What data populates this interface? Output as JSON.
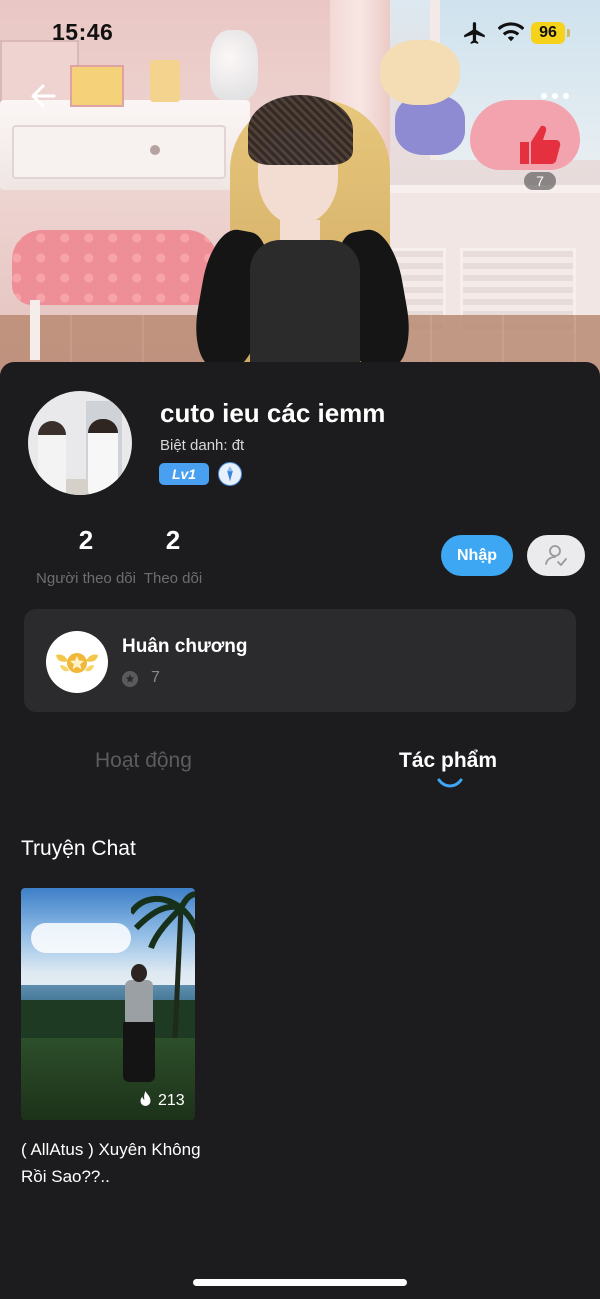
{
  "status_bar": {
    "time": "15:46",
    "battery": "96",
    "icons": [
      "airplane-mode-icon",
      "wifi-icon",
      "battery-icon"
    ]
  },
  "header": {
    "back_icon": "arrow-left-icon",
    "more_icon": "more-dots-icon",
    "like_icon": "thumbs-up-icon",
    "like_count": "7"
  },
  "profile": {
    "name": "cuto ieu các iemm",
    "nickname": "Biệt danh: đt",
    "level": "Lv1",
    "verified_icon": "verified-shield-icon"
  },
  "stats": {
    "followers": {
      "value": "2",
      "label": "Người theo dõi"
    },
    "following": {
      "value": "2",
      "label": "Theo dõi"
    }
  },
  "actions": {
    "enter_label": "Nhập",
    "follow_icon": "user-check-icon"
  },
  "medal": {
    "title": "Huân chương",
    "count": "7",
    "icon": "medal-icon"
  },
  "tabs": [
    {
      "label": "Hoạt động",
      "active": false
    },
    {
      "label": "Tác phẩm",
      "active": true
    }
  ],
  "section": {
    "title": "Truyện Chat"
  },
  "stories": [
    {
      "title": "( AllAtus ) Xuyên Không Rồi Sao??..",
      "views": "213",
      "view_icon": "fire-icon"
    }
  ],
  "colors": {
    "accent": "#3ea7f4",
    "background": "#1c1c1e",
    "card": "#2b2b2d",
    "level_badge": "#4aa0f0",
    "battery": "#f6d21a",
    "like": "#e5303f"
  }
}
